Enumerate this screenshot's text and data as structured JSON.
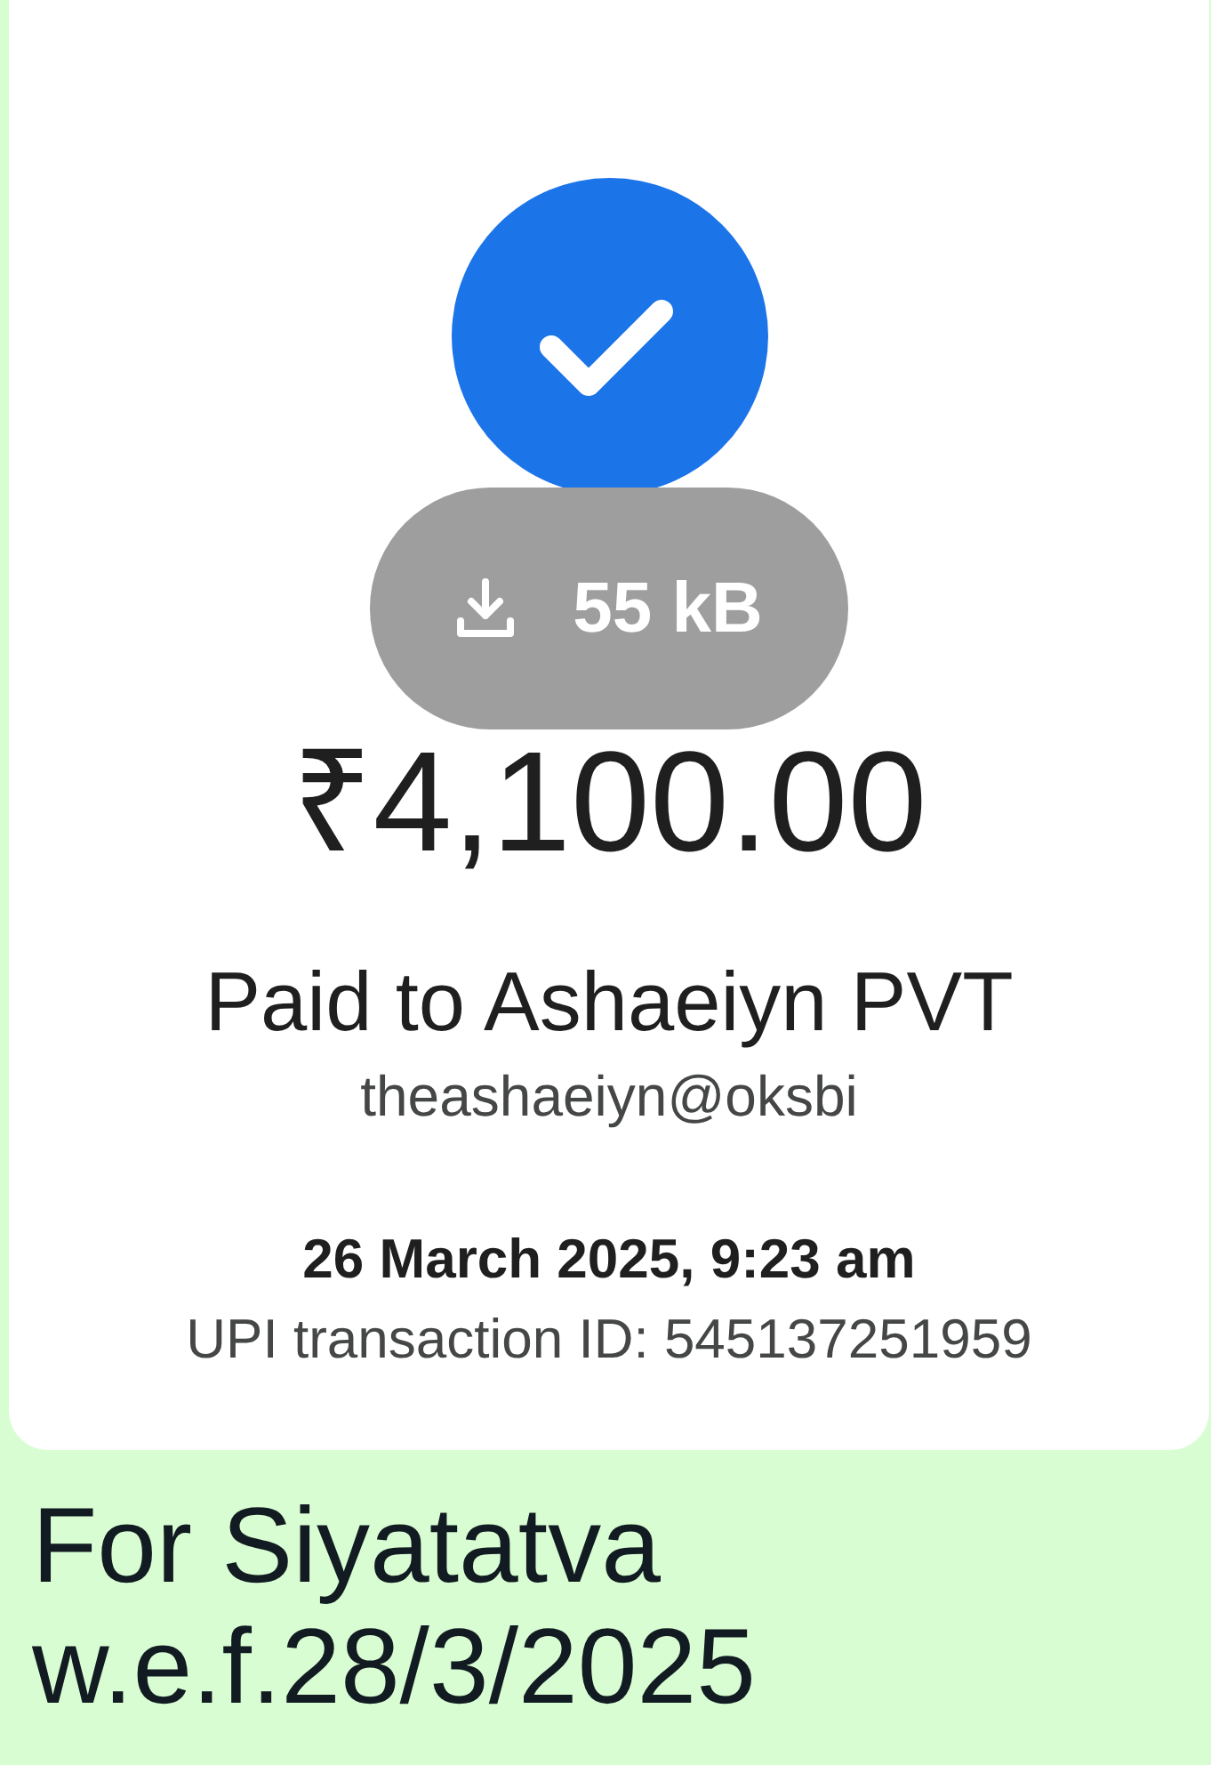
{
  "receipt": {
    "attachment": {
      "size": "55 kB"
    },
    "amount": "₹4,100.00",
    "paid_to": "Paid to Ashaeiyn PVT",
    "upi_id": "theashaeiyn@oksbi",
    "datetime": "26 March 2025, 9:23 am",
    "transaction_id": "UPI transaction ID: 545137251959"
  },
  "caption": "For Siyatatva\nw.e.f.28/3/2025"
}
